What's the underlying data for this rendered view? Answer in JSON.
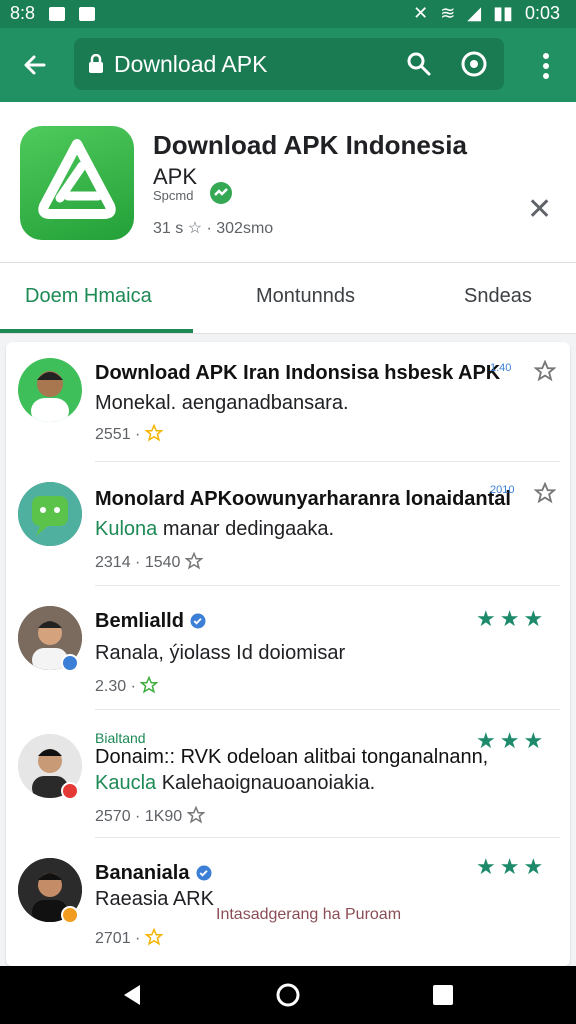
{
  "status_bar": {
    "time": "0:03",
    "left": "8:8"
  },
  "toolbar": {
    "url": "Download APK"
  },
  "app": {
    "title": "Download APK Indonesia",
    "subtitle": "APK",
    "developer": "Spcmd",
    "rating_line": "31 s ☆ · 302smo"
  },
  "tabs": [
    {
      "label": "Doem Hmaica",
      "active": true
    },
    {
      "label": "Montunnds",
      "active": false
    },
    {
      "label": "Sndeas",
      "active": false
    }
  ],
  "items": [
    {
      "title": "Download APK Iran Indonsisa hsbesk APK",
      "tag": "1.40",
      "desc": "Monekal. aenganadbansara.",
      "meta": "2551 ·",
      "rating": "☆"
    },
    {
      "title": "Monolard APKoowunyarharanra lonaidantal",
      "tag": "2010",
      "desc_prefix": "Kulona",
      "desc": "manar dedingaaka.",
      "meta": "2314 · 1540",
      "rating": "☆"
    },
    {
      "title": "Bemlialld",
      "desc": "Ranala, ýiolass Id doiomisar",
      "meta": "2.30 ·",
      "rating": "★★★"
    },
    {
      "label_top": "Bialtand",
      "title": "Donaim:: RVK odeloan alitbai tonganalnann,",
      "desc_prefix": "Kaucla",
      "desc": "Kalehaoignauoanoiakia.",
      "meta": "2570 · 1K90",
      "rating": "★★★"
    },
    {
      "title": "Bananiala",
      "desc": "Raeasia ARK",
      "link": "Intasadgerang ha Puroam",
      "meta": "2701 ·",
      "rating": "★★★"
    }
  ],
  "colors": {
    "accent": "#219163",
    "accent_dark": "#1a7a52",
    "star_green": "#1d8a6b",
    "star_yellow": "#f6b400"
  }
}
